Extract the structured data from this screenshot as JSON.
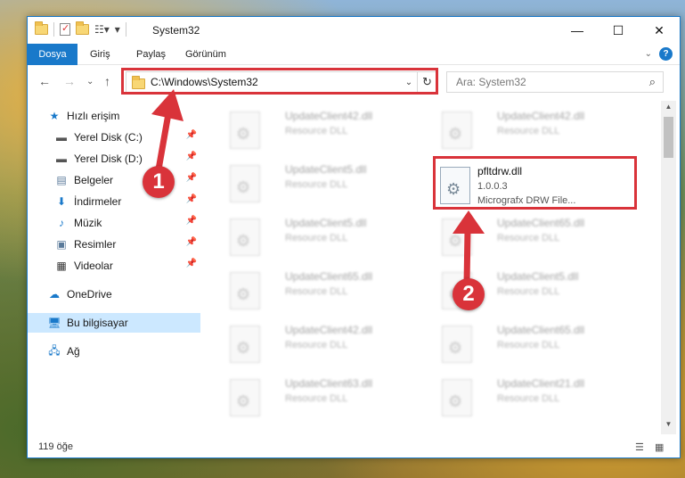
{
  "window": {
    "title": "System32",
    "controls": {
      "minimize": "—",
      "maximize": "☐",
      "close": "✕"
    }
  },
  "ribbon": {
    "tabs": [
      "Dosya",
      "Giriş",
      "Paylaş",
      "Görünüm"
    ],
    "help": "?"
  },
  "nav": {
    "back": "←",
    "forward": "→",
    "recent": "⌄",
    "up": "↑",
    "address": "C:\\Windows\\System32",
    "refresh": "↻",
    "search_placeholder": "Ara: System32",
    "search_icon": "⌕"
  },
  "sidebar": {
    "items": [
      {
        "label": "Hızlı erişim",
        "icon": "star-icon"
      },
      {
        "label": "Yerel Disk (C:)",
        "icon": "drive-icon",
        "pinned": true
      },
      {
        "label": "Yerel Disk (D:)",
        "icon": "drive-icon",
        "pinned": true
      },
      {
        "label": "Belgeler",
        "icon": "documents-icon",
        "pinned": true
      },
      {
        "label": "İndirmeler",
        "icon": "download-icon",
        "pinned": true
      },
      {
        "label": "Müzik",
        "icon": "music-icon",
        "pinned": true
      },
      {
        "label": "Resimler",
        "icon": "pictures-icon",
        "pinned": true
      },
      {
        "label": "Videolar",
        "icon": "videos-icon",
        "pinned": true
      },
      {
        "label": "OneDrive",
        "icon": "cloud-icon"
      },
      {
        "label": "Bu bilgisayar",
        "icon": "computer-icon",
        "selected": true
      },
      {
        "label": "Ağ",
        "icon": "network-icon"
      }
    ]
  },
  "files": {
    "tiles": [
      {
        "name": "UpdateClient42.dll",
        "desc": "Resource DLL"
      },
      {
        "name": "UpdateClient42.dll",
        "desc": "Resource DLL"
      },
      {
        "name": "UpdateClient5.dll",
        "desc": "Resource DLL"
      },
      {
        "name": "UpdateClient5.dll",
        "desc": "Resource DLL"
      },
      {
        "name": "UpdateClient65.dll",
        "desc": "Resource DLL"
      },
      {
        "name": "UpdateClient65.dll",
        "desc": "Resource DLL"
      },
      {
        "name": "UpdateClient5.dll",
        "desc": "Resource DLL"
      },
      {
        "name": "UpdateClient42.dll",
        "desc": "Resource DLL"
      },
      {
        "name": "UpdateClient65.dll",
        "desc": "Resource DLL"
      },
      {
        "name": "UpdateClient63.dll",
        "desc": "Resource DLL"
      },
      {
        "name": "UpdateClient21.dll",
        "desc": "Resource DLL"
      }
    ],
    "featured": {
      "name": "pfltdrw.dll",
      "version": "1.0.0.3",
      "desc": "Micrografx DRW File..."
    }
  },
  "status": {
    "count": "119 öğe"
  },
  "annotations": {
    "marker1": "1",
    "marker2": "2",
    "color": "#d9333a"
  }
}
